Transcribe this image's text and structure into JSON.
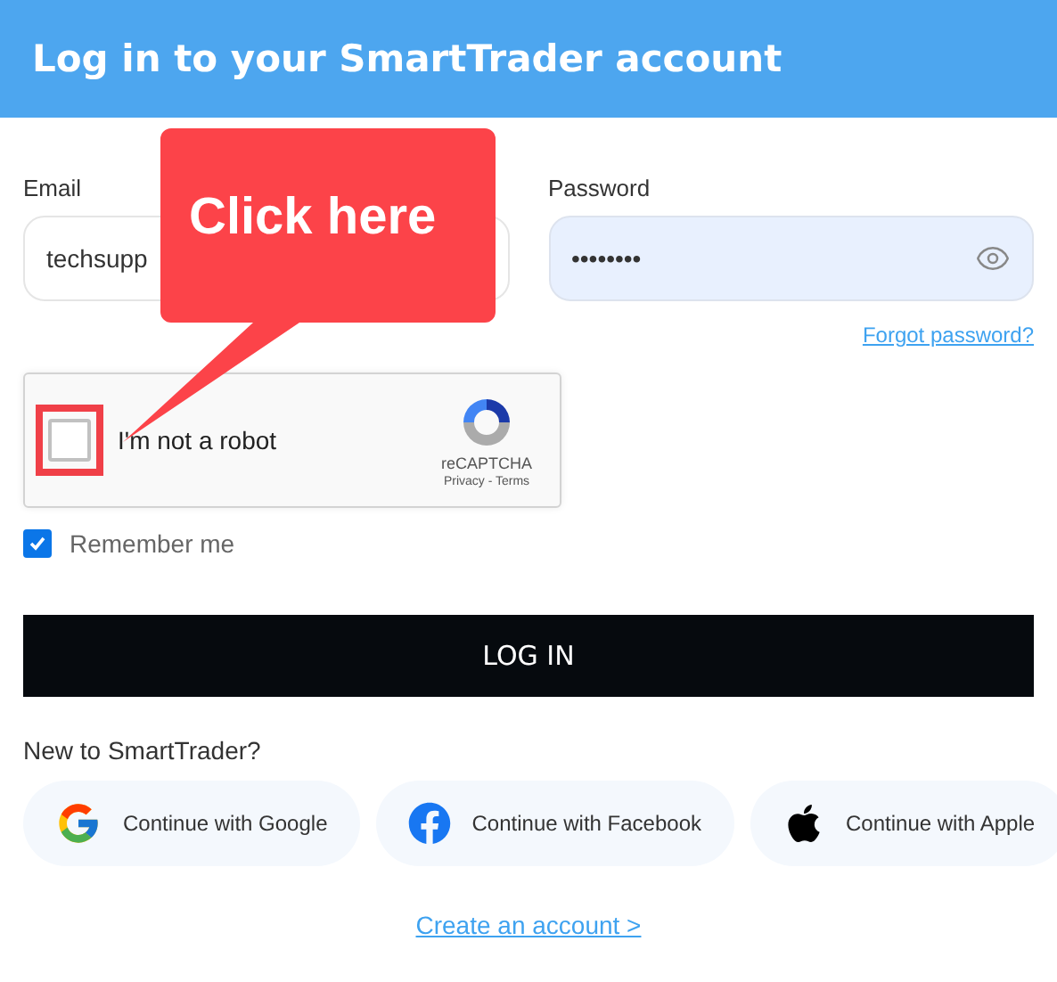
{
  "header": {
    "title": "Log in to your SmartTrader account"
  },
  "email": {
    "label": "Email",
    "value": "techsupp"
  },
  "password": {
    "label": "Password",
    "value": "••••••••"
  },
  "forgot_link": "Forgot password?",
  "captcha": {
    "label": "I'm not a robot",
    "checked": false,
    "brand": "reCAPTCHA",
    "links": "Privacy - Terms"
  },
  "remember": {
    "label": "Remember me",
    "checked": true
  },
  "login_button": "LOG IN",
  "signup_prompt": "New to SmartTrader?",
  "social": [
    {
      "kind": "google",
      "label": "Continue with Google"
    },
    {
      "kind": "facebook",
      "label": "Continue with Facebook"
    },
    {
      "kind": "apple",
      "label": "Continue with Apple"
    }
  ],
  "create_link": "Create an account >",
  "callout": {
    "text": "Click here"
  }
}
